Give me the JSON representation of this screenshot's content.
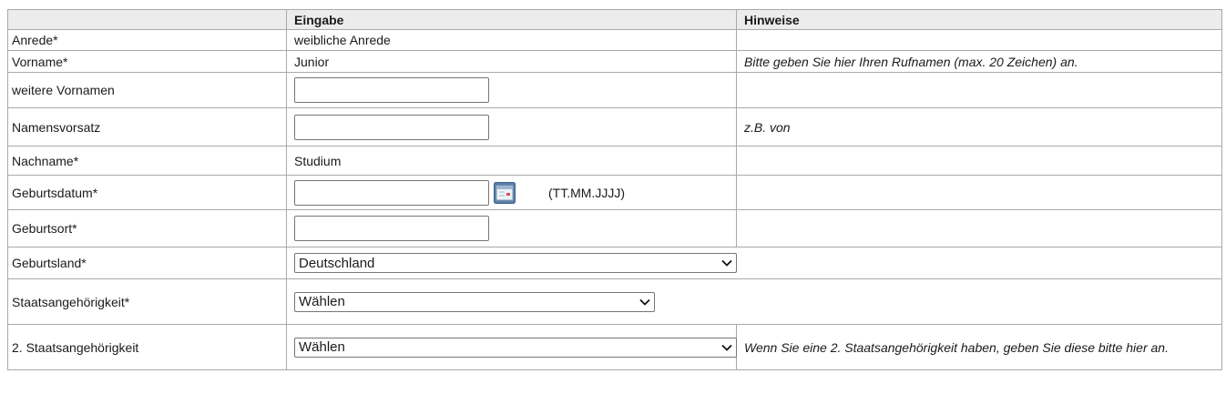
{
  "headers": {
    "label": "",
    "input": "Eingabe",
    "hints": "Hinweise"
  },
  "rows": {
    "anrede": {
      "label": "Anrede*",
      "value": "weibliche Anrede",
      "hint": ""
    },
    "vorname": {
      "label": "Vorname*",
      "value": "Junior",
      "hint": "Bitte geben Sie hier Ihren Rufnamen (max. 20 Zeichen) an."
    },
    "weitere_vornamen": {
      "label": "weitere Vornamen",
      "value": ""
    },
    "namensvorsatz": {
      "label": "Namensvorsatz",
      "value": "",
      "hint": "z.B. von"
    },
    "nachname": {
      "label": "Nachname*",
      "value": "Studium"
    },
    "geburtsdatum": {
      "label": "Geburtsdatum*",
      "value": "",
      "format": "(TT.MM.JJJJ)",
      "icon": "calendar-icon"
    },
    "geburtsort": {
      "label": "Geburtsort*",
      "value": ""
    },
    "geburtsland": {
      "label": "Geburtsland*",
      "selected": "Deutschland"
    },
    "staatsangehoerigkeit": {
      "label": "Staatsangehörigkeit*",
      "selected": "Wählen"
    },
    "staatsangehoerigkeit2": {
      "label": "2. Staatsangehörigkeit",
      "selected": "Wählen",
      "hint": "Wenn Sie eine 2. Staatsangehörigkeit haben, geben Sie diese bitte hier an."
    }
  },
  "colors": {
    "header_bg": "#ececec",
    "border": "#a9a9a9"
  }
}
